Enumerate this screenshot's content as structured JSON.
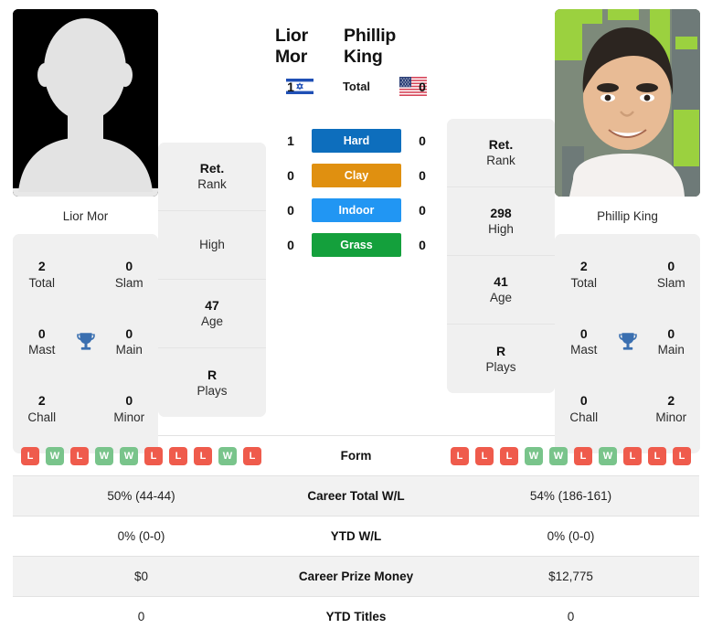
{
  "players": {
    "left": {
      "name": "Lior Mor",
      "photo_type": "placeholder-silhouette",
      "flag": "israel-flag",
      "trophies": {
        "total": {
          "value": "2",
          "label": "Total"
        },
        "slam": {
          "value": "0",
          "label": "Slam"
        },
        "mast": {
          "value": "0",
          "label": "Mast"
        },
        "main": {
          "value": "0",
          "label": "Main"
        },
        "chall": {
          "value": "2",
          "label": "Chall"
        },
        "minor": {
          "value": "0",
          "label": "Minor"
        }
      },
      "info": [
        {
          "value": "Ret.",
          "label": "Rank"
        },
        {
          "value": "",
          "label": "High"
        },
        {
          "value": "47",
          "label": "Age"
        },
        {
          "value": "R",
          "label": "Plays"
        }
      ],
      "form": [
        "L",
        "W",
        "L",
        "W",
        "W",
        "L",
        "L",
        "L",
        "W",
        "L"
      ],
      "career_total_wl": "50% (44-44)",
      "ytd_wl": "0% (0-0)",
      "career_prize_money": "$0",
      "ytd_titles": "0"
    },
    "right": {
      "name": "Phillip King",
      "photo_type": "portrait-photo",
      "flag": "usa-flag",
      "trophies": {
        "total": {
          "value": "2",
          "label": "Total"
        },
        "slam": {
          "value": "0",
          "label": "Slam"
        },
        "mast": {
          "value": "0",
          "label": "Mast"
        },
        "main": {
          "value": "0",
          "label": "Main"
        },
        "chall": {
          "value": "0",
          "label": "Chall"
        },
        "minor": {
          "value": "2",
          "label": "Minor"
        }
      },
      "info": [
        {
          "value": "Ret.",
          "label": "Rank"
        },
        {
          "value": "298",
          "label": "High"
        },
        {
          "value": "41",
          "label": "Age"
        },
        {
          "value": "R",
          "label": "Plays"
        }
      ],
      "form": [
        "L",
        "L",
        "L",
        "W",
        "W",
        "L",
        "W",
        "L",
        "L",
        "L"
      ],
      "career_total_wl": "54% (186-161)",
      "ytd_wl": "0% (0-0)",
      "career_prize_money": "$12,775",
      "ytd_titles": "0"
    }
  },
  "head_to_head": [
    {
      "label": "Total",
      "left": "1",
      "right": "0",
      "badge": false
    },
    {
      "label": "Hard",
      "left": "1",
      "right": "0",
      "badge": true,
      "color": "#0d6ebd"
    },
    {
      "label": "Clay",
      "left": "0",
      "right": "0",
      "badge": true,
      "color": "#e09010"
    },
    {
      "label": "Indoor",
      "left": "0",
      "right": "0",
      "badge": true,
      "color": "#2196f3"
    },
    {
      "label": "Grass",
      "left": "0",
      "right": "0",
      "badge": true,
      "color": "#14a03c"
    }
  ],
  "table_rows": [
    {
      "label": "Form",
      "type": "form",
      "shaded": false
    },
    {
      "label": "Career Total W/L",
      "type": "text",
      "shaded": true,
      "left": "50% (44-44)",
      "right": "54% (186-161)"
    },
    {
      "label": "YTD W/L",
      "type": "text",
      "shaded": false,
      "left": "0% (0-0)",
      "right": "0% (0-0)"
    },
    {
      "label": "Career Prize Money",
      "type": "text",
      "shaded": true,
      "left": "$0",
      "right": "$12,775"
    },
    {
      "label": "YTD Titles",
      "type": "text",
      "shaded": false,
      "left": "0",
      "right": "0"
    }
  ],
  "colors": {
    "hard": "#0d6ebd",
    "clay": "#e09010",
    "indoor": "#2196f3",
    "grass": "#14a03c",
    "win": "#79c48b",
    "loss": "#ef5b4c",
    "trophy": "#3a6fb0",
    "card_bg": "#f0f0f0"
  }
}
